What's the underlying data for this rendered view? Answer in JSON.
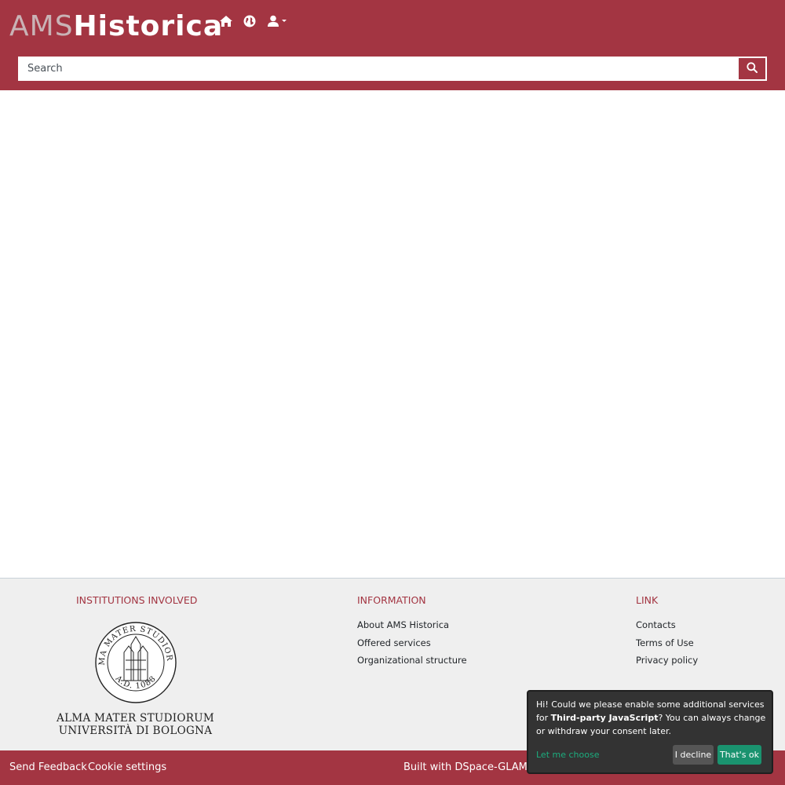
{
  "header": {
    "logo_prefix": "AMS",
    "logo_suffix": "Historica",
    "icons": [
      "home-icon",
      "globe-icon",
      "user-icon"
    ],
    "search": {
      "placeholder": "Search"
    }
  },
  "footer": {
    "institutions": {
      "heading": "INSTITUTIONS INVOLVED",
      "seal_text": "ALMA MATER STUDIORUM",
      "seal_year": "A.D. 1088",
      "name_line1": "ALMA MATER STUDIORUM",
      "name_line2": "UNIVERSITÀ DI BOLOGNA"
    },
    "information": {
      "heading": "INFORMATION",
      "links": [
        "About AMS Historica",
        "Offered services",
        "Organizational structure"
      ]
    },
    "link": {
      "heading": "LINK",
      "links": [
        "Contacts",
        "Terms of Use",
        "Privacy policy"
      ]
    }
  },
  "bottom_bar": {
    "send_feedback": "Send Feedback",
    "cookie_settings": "Cookie settings",
    "built_with": "Built with DSpace-GLAM - E"
  },
  "cookie_notice": {
    "text_before": "Hi! Could we please enable some additional services for ",
    "text_bold": "Third-party JavaScript",
    "text_after": "? You can always change or withdraw your consent later.",
    "let_me_choose": "Let me choose",
    "decline": "I decline",
    "accept": "That's ok"
  },
  "colors": {
    "brand": "#a33542",
    "footer_bg": "#efefef",
    "accept_green": "#1a936f"
  }
}
